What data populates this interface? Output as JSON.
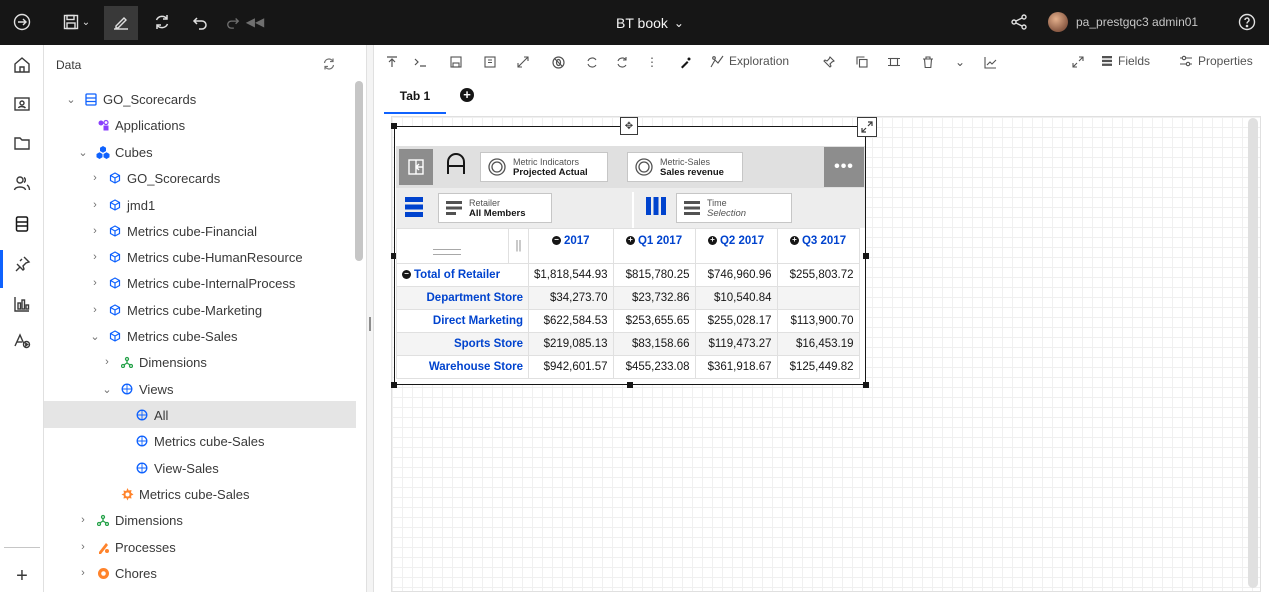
{
  "topbar": {
    "title": "BT book",
    "user": "pa_prestgqc3 admin01"
  },
  "panel": {
    "header": "Data",
    "tree": [
      {
        "label": "GO_Scorecards",
        "expanded": true
      },
      {
        "label": "Applications"
      },
      {
        "label": "Cubes",
        "expanded": true
      },
      {
        "label": "GO_Scorecards"
      },
      {
        "label": "jmd1"
      },
      {
        "label": "Metrics cube-Financial"
      },
      {
        "label": "Metrics cube-HumanResource"
      },
      {
        "label": "Metrics cube-InternalProcess"
      },
      {
        "label": "Metrics cube-Marketing"
      },
      {
        "label": "Metrics cube-Sales",
        "expanded": true
      },
      {
        "label": "Dimensions"
      },
      {
        "label": "Views",
        "expanded": true
      },
      {
        "label": "All",
        "selected": true
      },
      {
        "label": "Metrics cube-Sales"
      },
      {
        "label": "View-Sales"
      },
      {
        "label": "Metrics cube-Sales"
      },
      {
        "label": "Dimensions"
      },
      {
        "label": "Processes"
      },
      {
        "label": "Chores"
      }
    ]
  },
  "toolbar": {
    "exploration": "Exploration",
    "fields": "Fields",
    "properties": "Properties"
  },
  "tabs": [
    {
      "label": "Tab 1"
    }
  ],
  "widget": {
    "context": [
      {
        "title": "Metric Indicators",
        "value": "Projected Actual"
      },
      {
        "title": "Metric-Sales",
        "value": "Sales revenue"
      }
    ],
    "rows_chip": {
      "title": "Retailer",
      "value": "All Members"
    },
    "cols_chip": {
      "title": "Time",
      "value": "Selection"
    },
    "columns": [
      "2017",
      "Q1 2017",
      "Q2 2017",
      "Q3 2017"
    ],
    "rows": [
      {
        "label": "Total of Retailer",
        "values": [
          "$1,818,544.93",
          "$815,780.25",
          "$746,960.96",
          "$255,803.72"
        ]
      },
      {
        "label": "Department Store",
        "values": [
          "$34,273.70",
          "$23,732.86",
          "$10,540.84",
          ""
        ]
      },
      {
        "label": "Direct Marketing",
        "values": [
          "$622,584.53",
          "$253,655.65",
          "$255,028.17",
          "$113,900.70"
        ]
      },
      {
        "label": "Sports Store",
        "values": [
          "$219,085.13",
          "$83,158.66",
          "$119,473.27",
          "$16,453.19"
        ]
      },
      {
        "label": "Warehouse Store",
        "values": [
          "$942,601.57",
          "$455,233.08",
          "$361,918.67",
          "$125,449.82"
        ]
      }
    ]
  },
  "colors": {
    "accent": "#0f62fe",
    "link": "#0043ce",
    "topbar": "#161616"
  }
}
